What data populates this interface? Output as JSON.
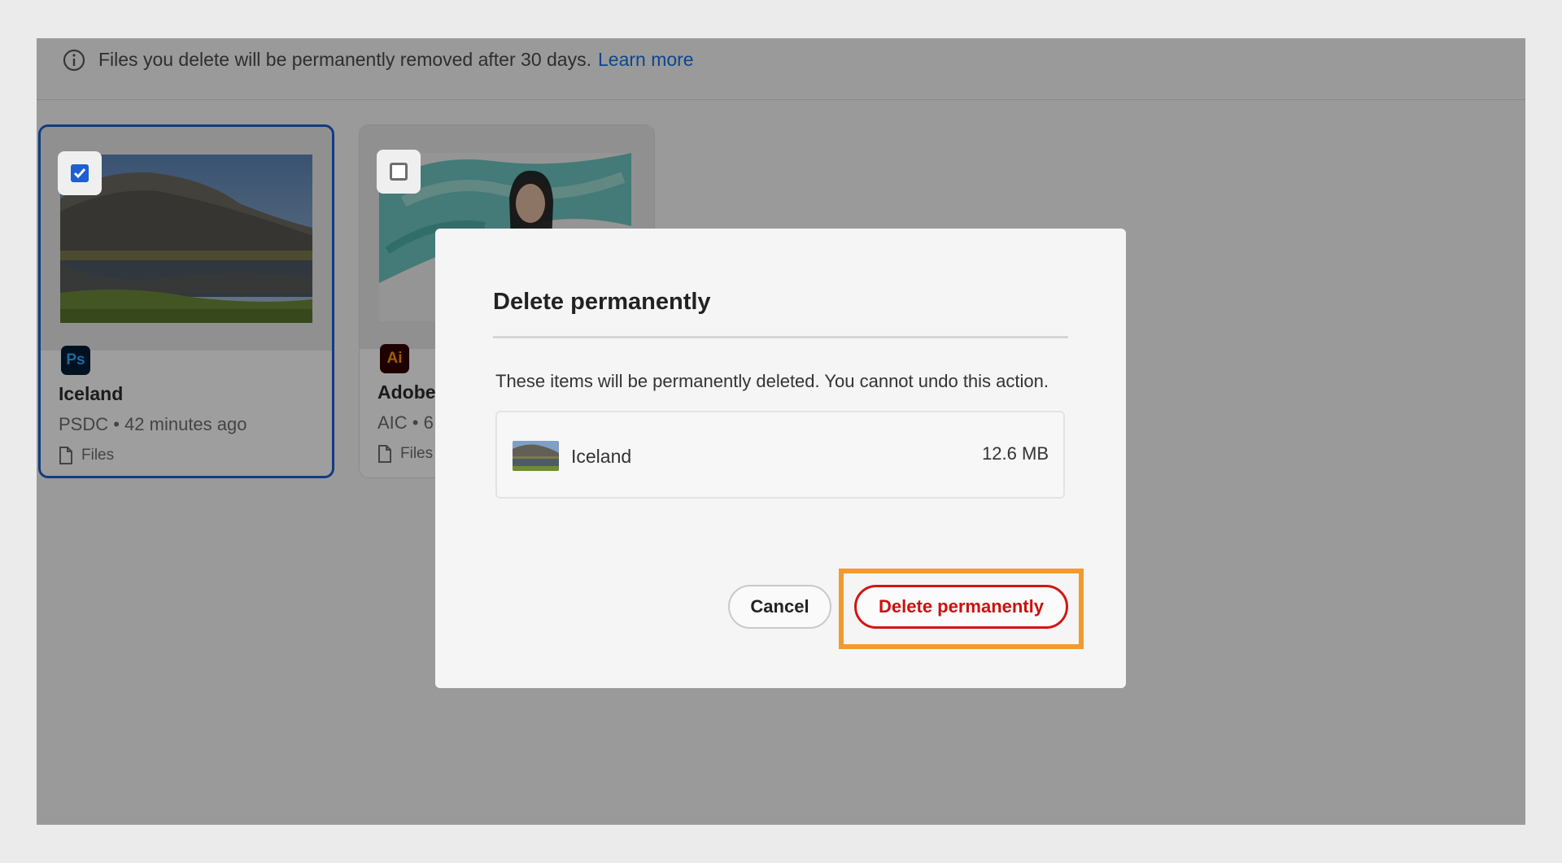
{
  "banner": {
    "message": "Files you delete will be permanently removed after 30 days.",
    "link": "Learn more",
    "icon": "info-icon"
  },
  "cards": [
    {
      "title": "Iceland",
      "meta": "PSDC • 42 minutes ago",
      "location": "Files",
      "app_badge": "Ps",
      "selected": true
    },
    {
      "title": "Adobe",
      "meta": "AIC • 6",
      "location": "Files",
      "app_badge": "Ai",
      "selected": false
    }
  ],
  "dialog": {
    "title": "Delete permanently",
    "message": "These items will be permanently deleted. You cannot undo this action.",
    "items": [
      {
        "name": "Iceland",
        "size": "12.6 MB"
      }
    ],
    "cancel_label": "Cancel",
    "confirm_label": "Delete permanently"
  },
  "colors": {
    "accent_blue": "#1e5fd1",
    "link_blue": "#1473e6",
    "danger_red": "#d31510",
    "highlight_orange": "#f29a2e",
    "overlay": "rgba(0,0,0,0.38)"
  }
}
